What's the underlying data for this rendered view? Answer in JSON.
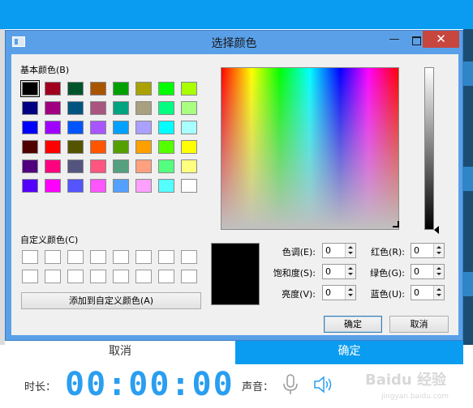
{
  "background_app": {
    "cancel_label": "取消",
    "confirm_label": "确定",
    "duration_label": "时长：",
    "timer": "00:00:00",
    "sound_label": "声音：",
    "watermark": "Baidu 经验",
    "watermark_sub": "jingyan.baidu.com"
  },
  "dialog": {
    "title": "选择颜色",
    "close_glyph": "✕",
    "minimize_glyph": "—",
    "basic_colors_label": "基本颜色(B)",
    "basic_colors": [
      "#000000",
      "#a0001e",
      "#00542c",
      "#a95500",
      "#00a000",
      "#a9a200",
      "#00ff00",
      "#a9ff00",
      "#000080",
      "#a00080",
      "#005580",
      "#a9557f",
      "#00a37f",
      "#a9a080",
      "#00ff80",
      "#a9ff80",
      "#0000ff",
      "#a000ff",
      "#0055ff",
      "#a955ff",
      "#00a0ff",
      "#a9a0ff",
      "#00ffff",
      "#a9ffff",
      "#500000",
      "#ff0000",
      "#545400",
      "#ff5500",
      "#54a000",
      "#ffa000",
      "#54ff00",
      "#ffff00",
      "#50007f",
      "#ff007f",
      "#54557f",
      "#ff557f",
      "#54a07f",
      "#ffa07f",
      "#54ff7f",
      "#ffff7f",
      "#5400ff",
      "#ff00ff",
      "#5455ff",
      "#ff55ff",
      "#54a0ff",
      "#ffa0ff",
      "#54ffff",
      "#ffffff"
    ],
    "custom_colors_label": "自定义颜色(C)",
    "add_custom_button": "添加到自定义颜色(A)",
    "fields": {
      "hue": {
        "label": "色调(E):",
        "value": "0"
      },
      "saturation": {
        "label": "饱和度(S):",
        "value": "0"
      },
      "luminance": {
        "label": "亮度(V):",
        "value": "0"
      },
      "red": {
        "label": "红色(R):",
        "value": "0"
      },
      "green": {
        "label": "绿色(G):",
        "value": "0"
      },
      "blue": {
        "label": "蓝色(U):",
        "value": "0"
      }
    },
    "current_color": "#000000",
    "ok_button": "确定",
    "cancel_button": "取消"
  }
}
